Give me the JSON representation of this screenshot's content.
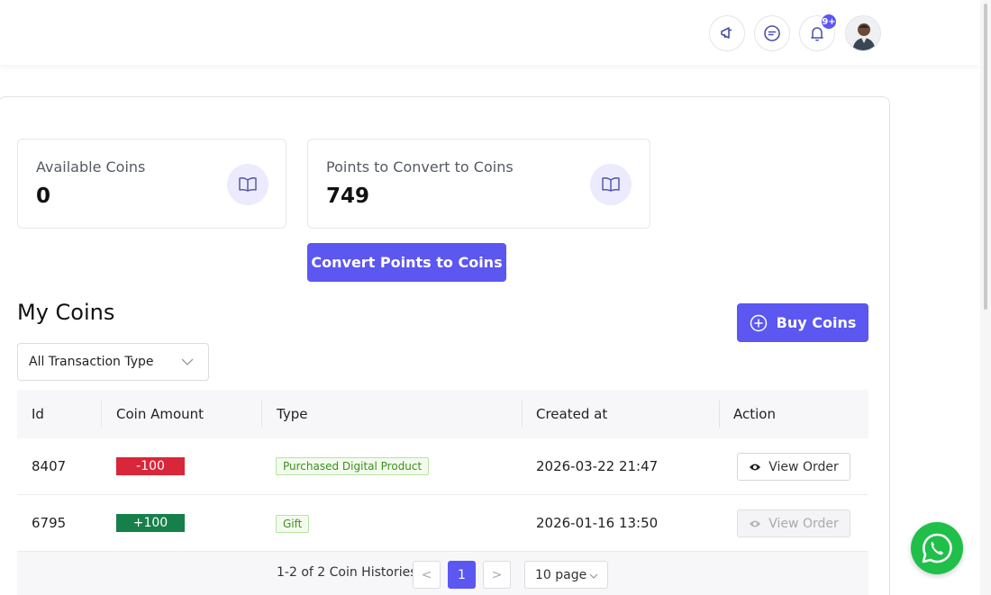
{
  "header": {
    "icons": [
      "megaphone-icon",
      "chat-icon",
      "bell-icon",
      "avatar"
    ],
    "notification_badge": "9+"
  },
  "stats": {
    "available_label": "Available Coins",
    "available_value": "0",
    "points_label": "Points to Convert to Coins",
    "points_value": "749"
  },
  "convert_button_label": "Convert Points to Coins",
  "section_title": "My Coins",
  "buy_button_label": "Buy Coins",
  "filter": {
    "selected": "All Transaction Type"
  },
  "table": {
    "columns": [
      "Id",
      "Coin Amount",
      "Type",
      "Created at",
      "Action"
    ],
    "rows": [
      {
        "id": "8407",
        "amount": "-100",
        "amount_color": "#d9263a",
        "type": "Purchased Digital Product",
        "created_at": "2026-03-22 21:47",
        "action": "View Order",
        "action_enabled": true
      },
      {
        "id": "6795",
        "amount": "+100",
        "amount_color": "#16804a",
        "type": "Gift",
        "created_at": "2026-01-16 13:50",
        "action": "View Order",
        "action_enabled": false
      }
    ]
  },
  "pagination": {
    "summary": "1-2 of 2 Coin Histories",
    "prev": "<",
    "current_page": "1",
    "next": ">",
    "page_size": "10 page"
  },
  "colors": {
    "accent": "#5b57f0",
    "negative": "#d9263a",
    "positive": "#16804a",
    "whatsapp": "#1fbf4a"
  }
}
